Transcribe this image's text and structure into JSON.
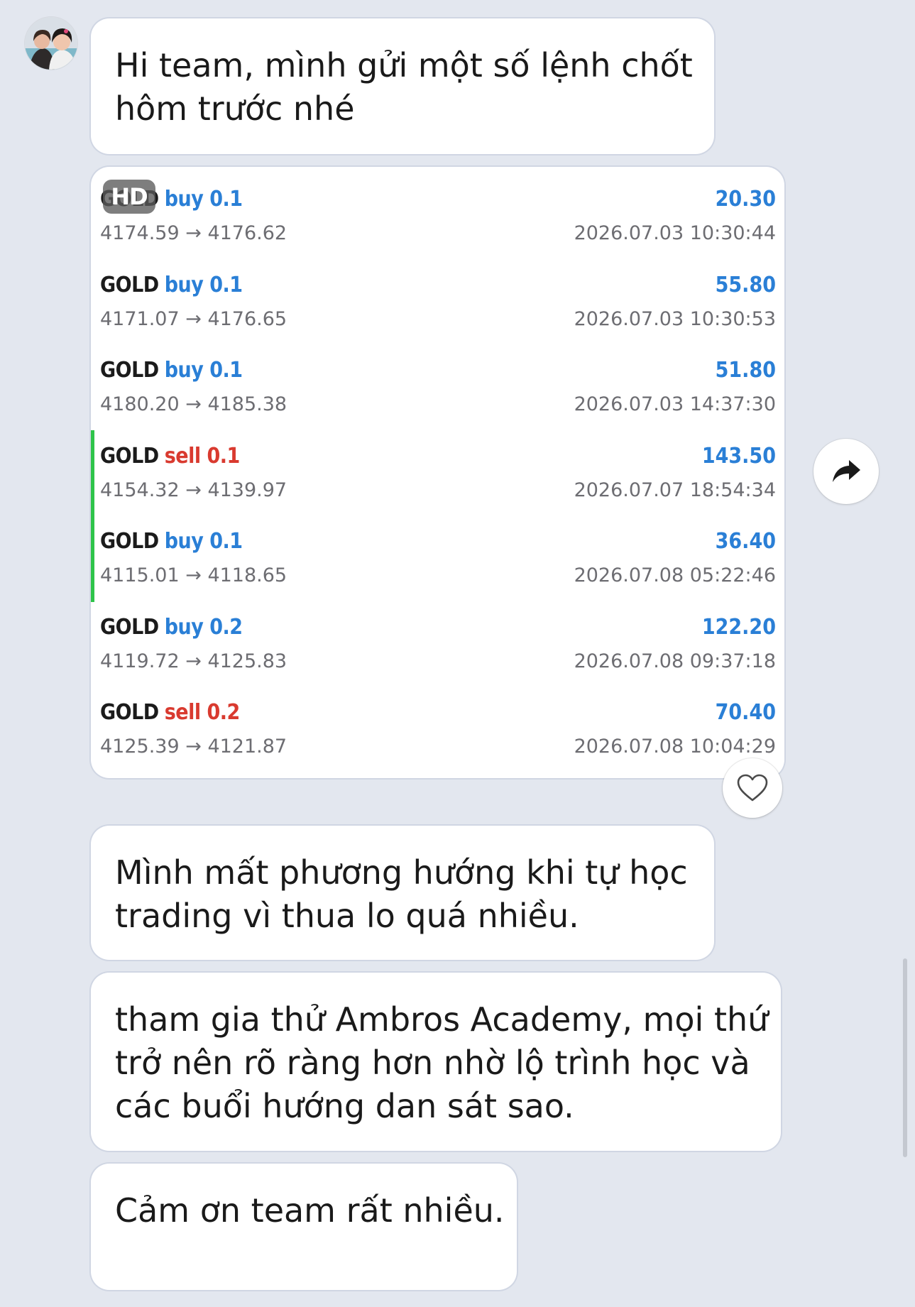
{
  "messages": [
    {
      "lines": [
        "Hi team, mình gửi một số lệnh chốt",
        "hôm trước nhé"
      ]
    },
    {
      "lines": [
        "Mình mất phương hướng khi tự học",
        "trading vì thua lo quá nhiều."
      ]
    },
    {
      "lines": [
        "tham gia thử Ambros Academy, mọi thứ",
        "trở nên rõ ràng hơn nhờ lộ trình học và",
        "các buổi hướng dan sát sao."
      ]
    },
    {
      "lines": [
        "Cảm ơn team rất nhiều."
      ]
    }
  ],
  "image_badge": "HD",
  "trades": [
    {
      "symbol": "GOLD",
      "side": "buy",
      "volume": "buy 0.1",
      "prices": "4174.59 → 4176.62",
      "profit": "20.30",
      "time": "2026.07.03 10:30:44"
    },
    {
      "symbol": "GOLD",
      "side": "buy",
      "volume": "buy 0.1",
      "prices": "4171.07 → 4176.65",
      "profit": "55.80",
      "time": "2026.07.03 10:30:53"
    },
    {
      "symbol": "GOLD",
      "side": "buy",
      "volume": "buy 0.1",
      "prices": "4180.20 → 4185.38",
      "profit": "51.80",
      "time": "2026.07.03 14:37:30"
    },
    {
      "symbol": "GOLD",
      "side": "sell",
      "volume": "sell 0.1",
      "prices": "4154.32 → 4139.97",
      "profit": "143.50",
      "time": "2026.07.07 18:54:34"
    },
    {
      "symbol": "GOLD",
      "side": "buy",
      "volume": "buy 0.1",
      "prices": "4115.01 → 4118.65",
      "profit": "36.40",
      "time": "2026.07.08 05:22:46"
    },
    {
      "symbol": "GOLD",
      "side": "buy",
      "volume": "buy 0.2",
      "prices": "4119.72 → 4125.83",
      "profit": "122.20",
      "time": "2026.07.08 09:37:18"
    },
    {
      "symbol": "GOLD",
      "side": "sell",
      "volume": "sell 0.2",
      "prices": "4125.39 → 4121.87",
      "profit": "70.40",
      "time": "2026.07.08 10:04:29"
    }
  ],
  "colors": {
    "background": "#e3e7ef",
    "buy": "#2a7fd6",
    "sell": "#d93a2f",
    "profit": "#2a7fd6",
    "marker": "#2ec44a"
  },
  "icons": {
    "avatar": "avatar-photo",
    "reaction": "heart-icon",
    "forward": "share-arrow-icon"
  }
}
